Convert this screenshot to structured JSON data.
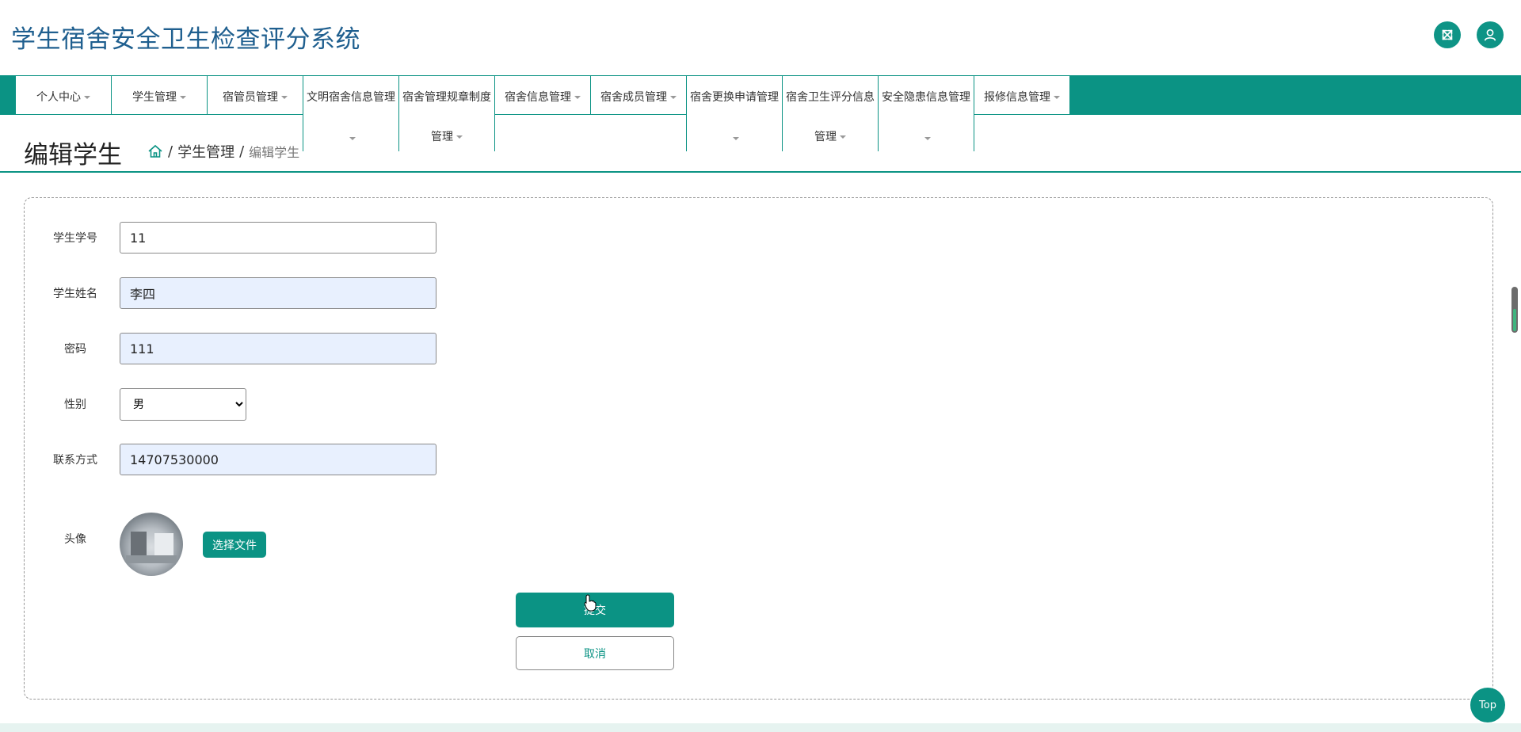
{
  "app": {
    "title": "学生宿舍安全卫生检查评分系统"
  },
  "header": {
    "icons": [
      "fullscreen-icon",
      "user-icon"
    ]
  },
  "nav": {
    "items": [
      {
        "label": "个人中心"
      },
      {
        "label": "学生管理"
      },
      {
        "label": "宿管员管理"
      },
      {
        "label": "文明宿舍信息管理"
      },
      {
        "label": "宿舍管理规章制度",
        "label2": "管理"
      },
      {
        "label": "宿舍信息管理"
      },
      {
        "label": "宿舍成员管理"
      },
      {
        "label": "宿舍更换申请管理"
      },
      {
        "label": "宿舍卫生评分信息",
        "label2": "管理"
      },
      {
        "label": "安全隐患信息管理"
      },
      {
        "label": "报修信息管理"
      }
    ]
  },
  "page": {
    "title": "编辑学生",
    "breadcrumb": {
      "sep": "/",
      "section": "学生管理",
      "current": "编辑学生"
    }
  },
  "form": {
    "student_id": {
      "label": "学生学号",
      "value": "11"
    },
    "student_name": {
      "label": "学生姓名",
      "value": "李四"
    },
    "password": {
      "label": "密码",
      "value": "111"
    },
    "gender": {
      "label": "性别",
      "value": "男",
      "options": [
        "男"
      ]
    },
    "phone": {
      "label": "联系方式",
      "value": "14707530000"
    },
    "avatar": {
      "label": "头像",
      "button": "选择文件"
    },
    "submit": "提交",
    "cancel": "取消"
  },
  "top_button": "Top",
  "colors": {
    "accent": "#0b9384",
    "title": "#1f5f8f",
    "autofill": "#e8f0fe"
  }
}
